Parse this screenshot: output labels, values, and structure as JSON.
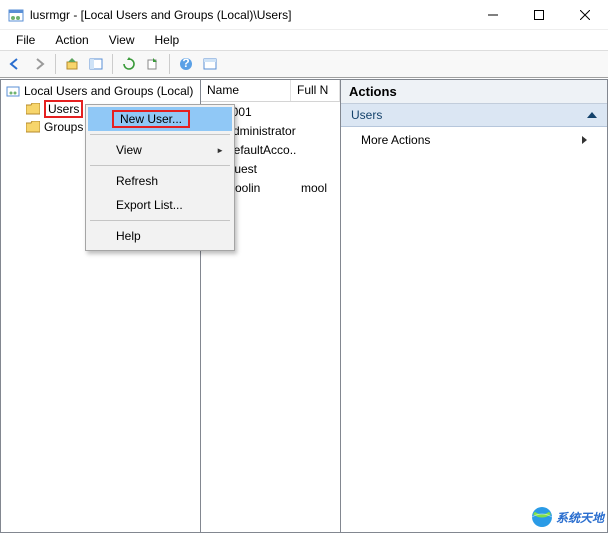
{
  "titlebar": {
    "title": "lusrmgr - [Local Users and Groups (Local)\\Users]"
  },
  "menubar": {
    "items": [
      "File",
      "Action",
      "View",
      "Help"
    ]
  },
  "tree": {
    "root": "Local Users and Groups (Local)",
    "items": [
      {
        "label": "Users",
        "selected": true
      },
      {
        "label": "Groups",
        "selected": false
      }
    ]
  },
  "list": {
    "columns": [
      "Name",
      "Full N"
    ],
    "rows": [
      {
        "name": "5001",
        "full": ""
      },
      {
        "name": "Administrator",
        "full": ""
      },
      {
        "name": "DefaultAcco...",
        "full": ""
      },
      {
        "name": "Guest",
        "full": ""
      },
      {
        "name": "moolin",
        "full": "mool"
      }
    ]
  },
  "context_menu": {
    "items": [
      {
        "label": "New User...",
        "highlighted": true
      },
      {
        "sep": true
      },
      {
        "label": "View",
        "submenu": true
      },
      {
        "sep": true
      },
      {
        "label": "Refresh"
      },
      {
        "label": "Export List..."
      },
      {
        "sep": true
      },
      {
        "label": "Help"
      }
    ]
  },
  "actions": {
    "header": "Actions",
    "group": "Users",
    "items": [
      "More Actions"
    ]
  },
  "watermark": "系统天地"
}
